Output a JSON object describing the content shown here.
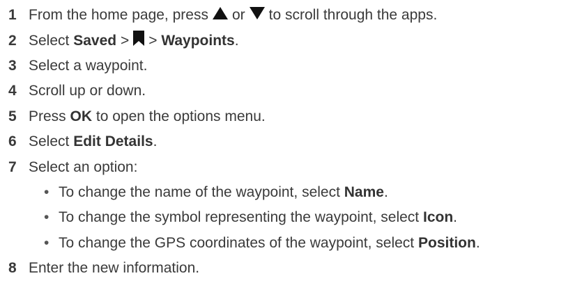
{
  "steps": [
    {
      "number": "1",
      "parts": {
        "t1": "From the home page, press",
        "icon1": "up-triangle-icon",
        "t2": "or",
        "icon2": "down-triangle-icon",
        "t3": "to scroll through the apps."
      }
    },
    {
      "number": "2",
      "parts": {
        "t1": "Select",
        "b1": "Saved",
        "sep1": ">",
        "icon1": "bookmark-icon",
        "sep2": ">",
        "b2": "Waypoints",
        "end": "."
      }
    },
    {
      "number": "3",
      "text": "Select a waypoint."
    },
    {
      "number": "4",
      "text": "Scroll up or down."
    },
    {
      "number": "5",
      "parts": {
        "t1": "Press",
        "b1": "OK",
        "t2": "to open the options menu."
      }
    },
    {
      "number": "6",
      "parts": {
        "t1": "Select",
        "b1": "Edit Details",
        "end": "."
      }
    },
    {
      "number": "7",
      "text": "Select an option:",
      "options": [
        {
          "bullet": "•",
          "text": "To change the name of the waypoint, select",
          "bold": "Name",
          "end": "."
        },
        {
          "bullet": "•",
          "text": "To change the symbol representing the waypoint, select",
          "bold": "Icon",
          "end": "."
        },
        {
          "bullet": "•",
          "text": "To change the GPS coordinates of the waypoint, select",
          "bold": "Position",
          "end": "."
        }
      ]
    },
    {
      "number": "8",
      "text": "Enter the new information."
    }
  ],
  "colors": {
    "text": "#3a3a3a",
    "icon": "#111111"
  }
}
